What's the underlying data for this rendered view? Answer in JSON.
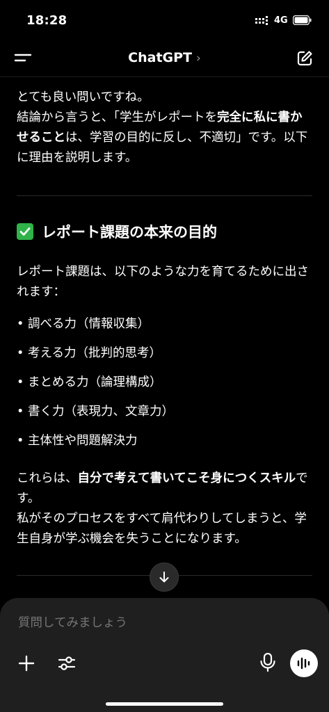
{
  "status_bar": {
    "time": "18:28",
    "network": "4G"
  },
  "header": {
    "title": "ChatGPT",
    "title_chevron": "›",
    "menu_icon": "menu-icon",
    "edit_icon": "new-chat-icon"
  },
  "message": {
    "intro_line1": "とても良い問いですね。",
    "intro_line2_a": "結論から言うと、「学生がレポートを",
    "intro_line2_b": "完全に私に書かせること",
    "intro_line2_c": "は、学習の目的に反し、不適切」です。以下に理由を説明します。",
    "heading": "レポート課題の本来の目的",
    "heading_icon": "check-mark-button-icon",
    "lead": "レポート課題は、以下のような力を育てるために出されます：",
    "bullets": [
      "調べる力（情報収集）",
      "考える力（批判的思考）",
      "まとめる力（論理構成）",
      "書く力（表現力、文章力）",
      "主体性や問題解決力"
    ],
    "closing_a": "これらは、",
    "closing_b": "自分で考えて書いてこそ身につくスキル",
    "closing_c": "です。",
    "closing2": "私がそのプロセスをすべて肩代わりしてしまうと、学生自身が学ぶ機会を失うことになります。"
  },
  "composer": {
    "placeholder": "質問してみましょう"
  },
  "colors": {
    "background": "#000000",
    "composer_bg": "#1f1f1f",
    "check_green": "#2fb34a",
    "placeholder": "#8a8a8a"
  }
}
